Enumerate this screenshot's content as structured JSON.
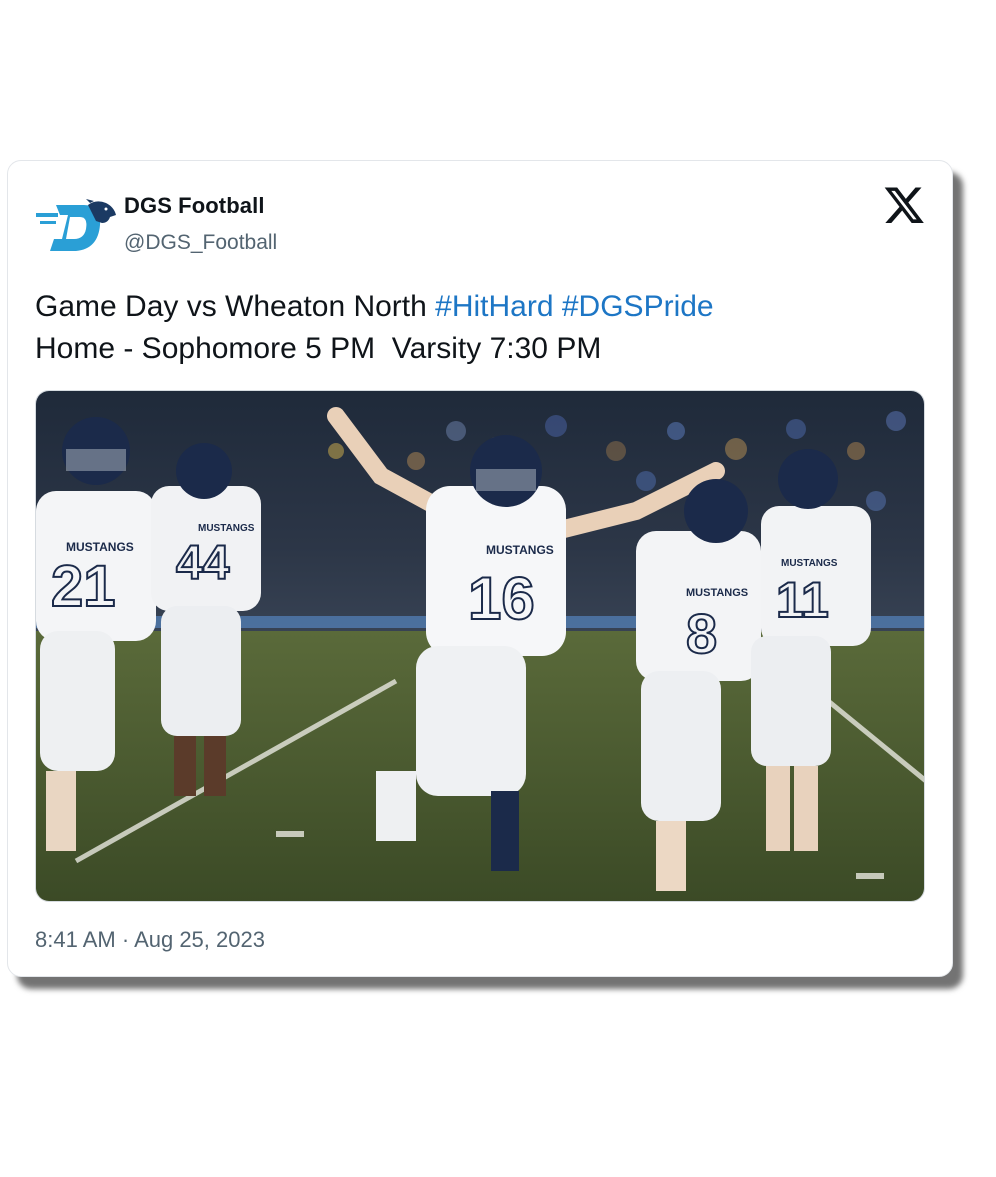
{
  "tweet": {
    "display_name": "DGS Football",
    "handle": "@DGS_Football",
    "text_line1_plain": "Game Day vs Wheaton North ",
    "hashtags": [
      "#HitHard",
      "#DGSPride"
    ],
    "text_line2": "Home - Sophomore 5 PM  Varsity 7:30 PM",
    "time": "8:41 AM",
    "separator": " · ",
    "date": "Aug 25, 2023"
  },
  "media": {
    "alt": "Football players in white Mustangs uniforms celebrating on the field",
    "jersey_text": "MUSTANGS",
    "jersey_numbers": [
      "21",
      "44",
      "16",
      "8",
      "11"
    ]
  },
  "icons": {
    "avatar": "dgs-mustang-logo",
    "platform": "x-logo-icon"
  },
  "colors": {
    "hashtag": "#1d76c5",
    "text": "#0f1419",
    "secondary": "#536471",
    "logo_blue": "#2a9fd6",
    "logo_navy": "#1b3a63"
  }
}
